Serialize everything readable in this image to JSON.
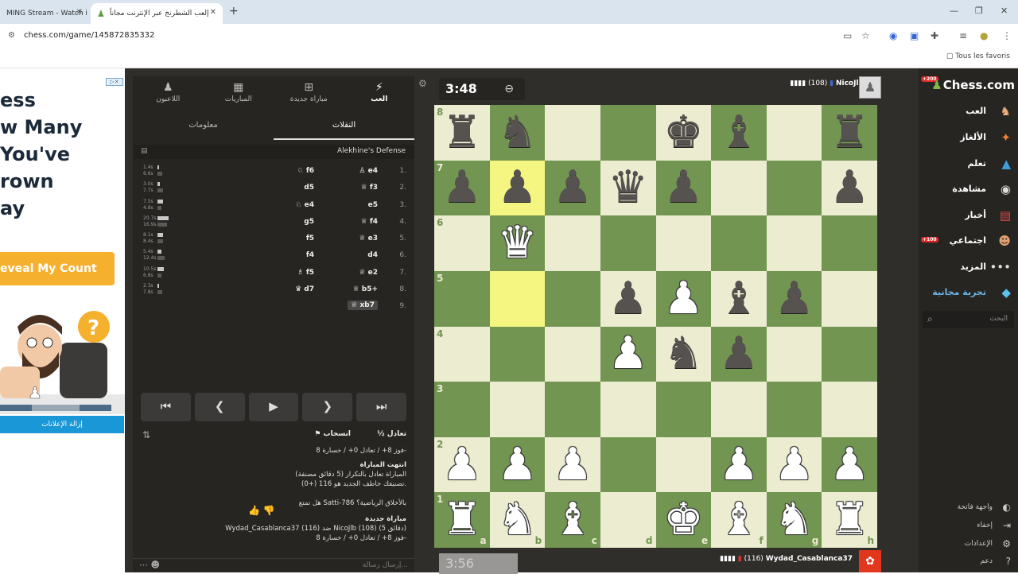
{
  "browser": {
    "tabs": [
      {
        "title": "MING Stream - Watch i"
      },
      {
        "title": "إلعب الشطرنج عبر الإنترنت مجاناً"
      }
    ],
    "url": "chess.com/game/145872835332",
    "bookmarks_label": "Tous les favoris"
  },
  "ad": {
    "lines": [
      "ess",
      "w Many",
      "You've",
      "rown",
      "ay"
    ],
    "button": "eveal My Count",
    "remove": "إزالة الإعلانات"
  },
  "panel": {
    "nav": [
      {
        "label": "العب",
        "icon": "lightning-icon"
      },
      {
        "label": "مباراة جديدة",
        "icon": "plus-icon"
      },
      {
        "label": "المباريات",
        "icon": "board-icon"
      },
      {
        "label": "اللاعبون",
        "icon": "players-icon"
      }
    ],
    "subtabs": [
      "النقلات",
      "معلومات"
    ],
    "opening": "Alekhine's Defense",
    "moves": [
      {
        "n": "1.",
        "w": "e4",
        "b": "f6",
        "t1": "1.4s",
        "t2": "6.6s"
      },
      {
        "n": "2.",
        "w": "f3",
        "b": "d5",
        "t1": "3.0s",
        "t2": "7.7s"
      },
      {
        "n": "3.",
        "w": "e5",
        "b": "e4",
        "t1": "7.5s",
        "t2": "4.8s"
      },
      {
        "n": "4.",
        "w": "f4",
        "b": "g5",
        "t1": "20.7s",
        "t2": "16.9s"
      },
      {
        "n": "5.",
        "w": "e3",
        "b": "f5",
        "t1": "8.1s",
        "t2": "8.4s"
      },
      {
        "n": "6.",
        "w": "d4",
        "b": "f4",
        "t1": "5.4s",
        "t2": "12.4s"
      },
      {
        "n": "7.",
        "w": "e2",
        "b": "f5",
        "t1": "10.5s",
        "t2": "6.8s"
      },
      {
        "n": "8.",
        "w": "b5+",
        "b": "d7",
        "t1": "2.3s",
        "t2": "7.8s"
      },
      {
        "n": "9.",
        "w": "xb7",
        "b": "",
        "t1": "",
        "t2": ""
      }
    ],
    "draw": "½ تعادل",
    "resign": "انسحاب",
    "chat": [
      "فوز 8+ / تعادل 0+ / خسارة 8-",
      "انتهت المباراة",
      "المباراة تعادل بالتكرار (5 دقائق مصنفة)",
      "تصنيفك خاطف الجديد هو 116 (+0).",
      "هل تمتع Satti-786 بالأخلاق الرياضية؟",
      "مباراة جديدة",
      "Wydad_Casablanca37 (116) ضد NicoJlb (108) (5 دقائق)",
      "فوز 8+ / تعادل 0+ / خسارة 8-"
    ],
    "chat_placeholder": "إرسال رسالة..."
  },
  "game": {
    "top_clock": "3:48",
    "top_player": "NicoJlb",
    "top_rating": "(108)",
    "bottom_clock": "3:56",
    "bottom_player": "Wydad_Casablanca37",
    "bottom_rating": "(116)",
    "board": [
      [
        "♜",
        "♞",
        "",
        "",
        "♚",
        "♝",
        "",
        "♜"
      ],
      [
        "♟",
        "♟",
        "♟",
        "♛",
        "♟",
        "",
        "",
        "♟"
      ],
      [
        "",
        "♕",
        "",
        "",
        "",
        "",
        "",
        ""
      ],
      [
        "",
        "",
        "",
        "♟",
        "♙",
        "♝",
        "♟",
        ""
      ],
      [
        "",
        "",
        "",
        "♙",
        "♞",
        "♟",
        "",
        ""
      ],
      [
        "",
        "",
        "",
        "",
        "",
        "",
        "",
        ""
      ],
      [
        "♙",
        "♙",
        "♙",
        "",
        "",
        "♙",
        "♙",
        "♙"
      ],
      [
        "♖",
        "♘",
        "♗",
        "",
        "♔",
        "♗",
        "♘",
        "♖"
      ]
    ],
    "files": [
      "a",
      "b",
      "c",
      "d",
      "e",
      "f",
      "g",
      "h"
    ],
    "ranks": [
      "8",
      "7",
      "6",
      "5",
      "4",
      "3",
      "2",
      "1"
    ]
  },
  "sidebar": {
    "logo": "Chess.com",
    "items": [
      {
        "label": "العب",
        "icon": "play-icon"
      },
      {
        "label": "الألغاز",
        "icon": "puzzle-icon"
      },
      {
        "label": "تعلم",
        "icon": "learn-icon"
      },
      {
        "label": "مشاهدة",
        "icon": "watch-icon"
      },
      {
        "label": "أخبار",
        "icon": "news-icon"
      },
      {
        "label": "اجتماعي",
        "icon": "social-icon"
      },
      {
        "label": "المزيد",
        "icon": "more-icon"
      },
      {
        "label": "تجربة مجانية",
        "icon": "diamond-icon"
      }
    ],
    "search_placeholder": "البحث",
    "bottom": [
      {
        "label": "واجهة فاتحة",
        "icon": "theme-icon"
      },
      {
        "label": "إخفاء",
        "icon": "collapse-icon"
      },
      {
        "label": "الإعدادات",
        "icon": "settings-icon"
      },
      {
        "label": "دعم",
        "icon": "help-icon"
      }
    ],
    "badges": [
      "200",
      "100"
    ]
  }
}
